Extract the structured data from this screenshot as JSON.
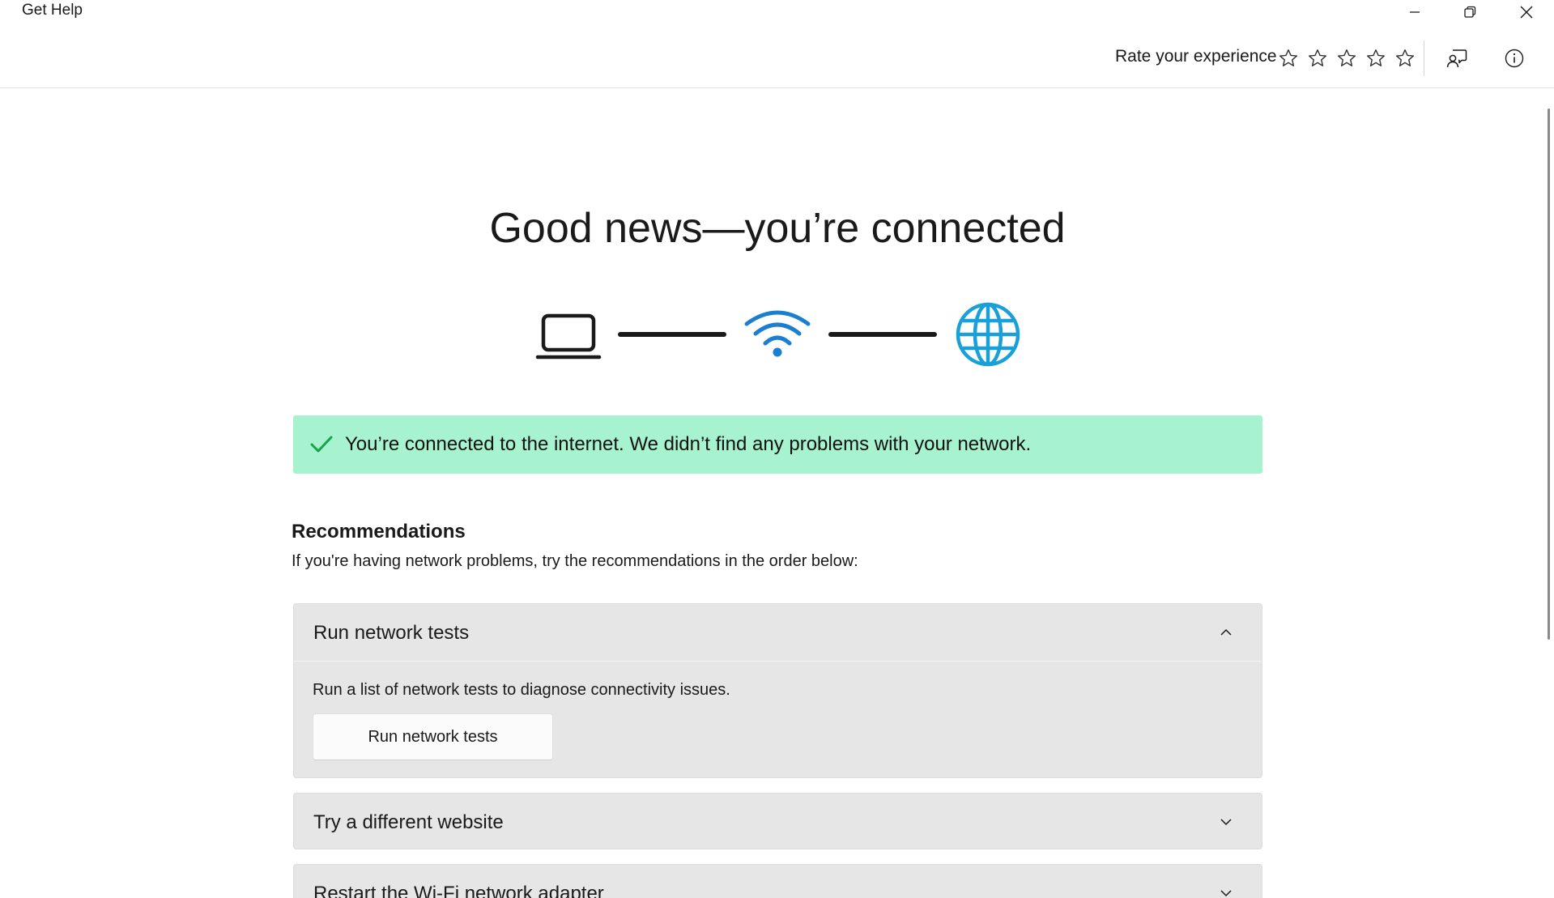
{
  "window": {
    "title": "Get Help",
    "controls": {
      "minimize": "minimize",
      "maximize": "restore",
      "close": "close"
    }
  },
  "header": {
    "rate_label": "Rate your experience",
    "stars_total": 5,
    "stars_filled": 0,
    "feedback_icon": "feedback-icon",
    "info_icon": "info-icon"
  },
  "main": {
    "headline": "Good news—you’re connected",
    "diagram": {
      "nodes": [
        "laptop-icon",
        "wifi-icon",
        "globe-icon"
      ]
    },
    "status": {
      "text": "You’re connected to the internet. We didn’t find any problems with your network.",
      "icon": "check-icon",
      "color": "#a7f3d0"
    },
    "recommendations": {
      "title": "Recommendations",
      "subtitle": "If you're having network problems, try the recommendations in the order below:",
      "items": [
        {
          "title": "Run network tests",
          "expanded": true,
          "description": "Run a list of network tests to diagnose connectivity issues.",
          "button_label": "Run network tests"
        },
        {
          "title": "Try a different website",
          "expanded": false
        },
        {
          "title": "Restart the Wi-Fi network adapter",
          "expanded": false
        }
      ]
    }
  },
  "colors": {
    "wifi": "#1a7fd1",
    "globe": "#1aa0d8",
    "success_banner": "#a7f3d0",
    "check": "#16a34a",
    "accordion_bg": "#e6e6e6"
  }
}
